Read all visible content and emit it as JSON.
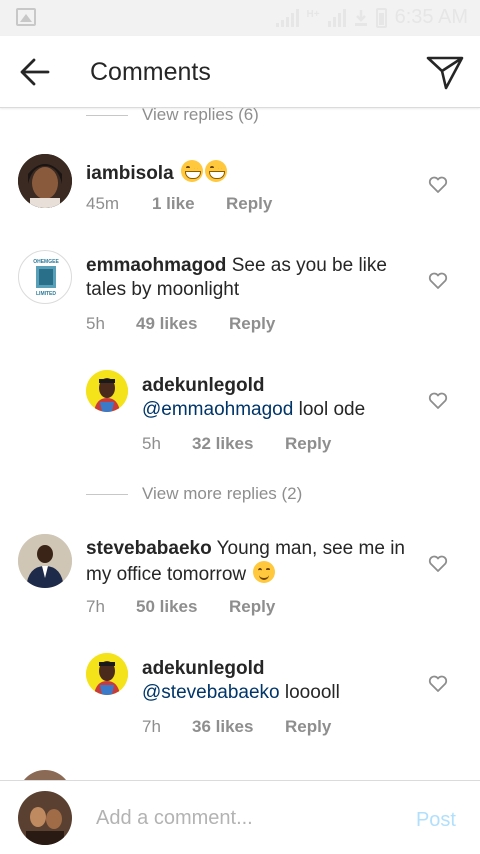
{
  "status_bar": {
    "time": "6:35 AM",
    "network": "H+"
  },
  "header": {
    "title": "Comments"
  },
  "thread": {
    "view_replies_top": "View replies (6)",
    "view_more_replies": "View more replies (2)"
  },
  "comments": [
    {
      "user": "iambisola",
      "text": "",
      "time": "45m",
      "likes": "1 like",
      "reply": "Reply"
    },
    {
      "user": "emmaohmagod",
      "text": "See as you be like tales by moonlight",
      "time": "5h",
      "likes": "49 likes",
      "reply": "Reply",
      "avatar_text": [
        "OHEMGEE",
        "LIMITED"
      ]
    },
    {
      "user": "adekunlegold",
      "mention": "@emmaohmagod",
      "text": "lool ode",
      "time": "5h",
      "likes": "32 likes",
      "reply": "Reply"
    },
    {
      "user": "stevebabaeko",
      "text": "Young man, see me in my office tomorrow",
      "time": "7h",
      "likes": "50 likes",
      "reply": "Reply"
    },
    {
      "user": "adekunlegold",
      "mention": "@stevebabaeko",
      "text": "looooll",
      "time": "7h",
      "likes": "36 likes",
      "reply": "Reply"
    }
  ],
  "composer": {
    "placeholder": "Add a comment...",
    "post_label": "Post"
  },
  "colors": {
    "link": "#003569",
    "meta": "#8e8e8e",
    "post": "#b2dffc"
  }
}
